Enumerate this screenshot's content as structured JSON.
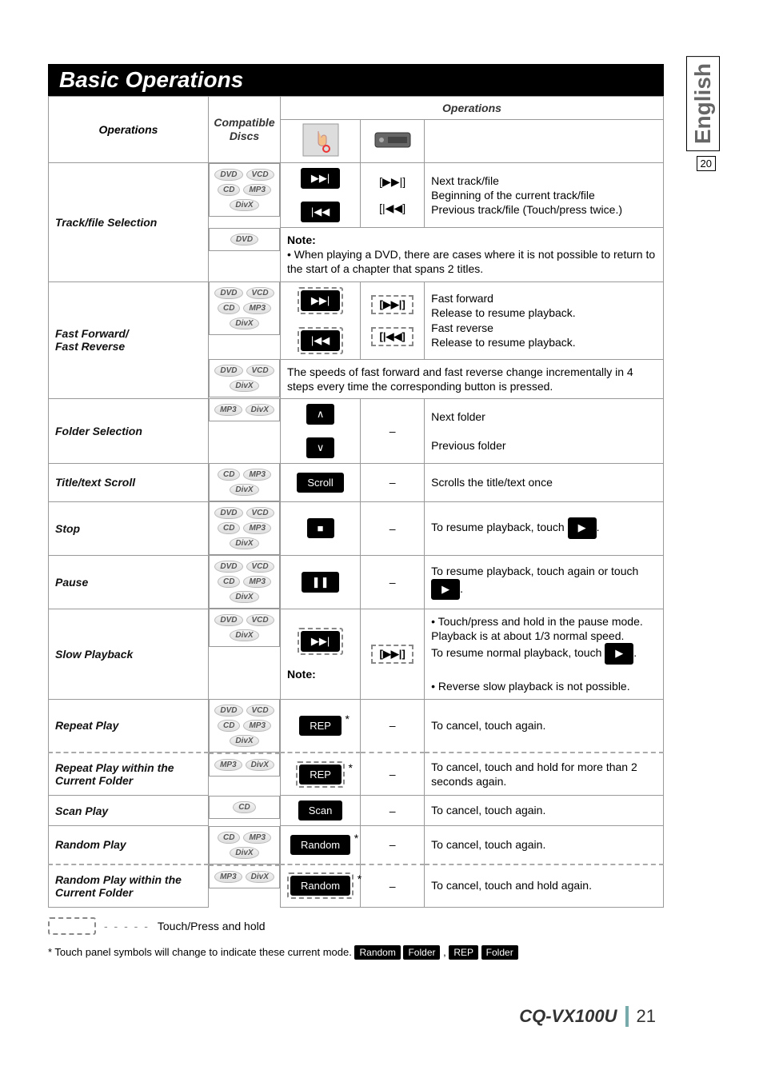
{
  "side_tab": {
    "lang": "English",
    "num": "20"
  },
  "section_title": "Basic Operations",
  "headers": {
    "operations_left": "Operations",
    "compatible_discs": "Compatible Discs",
    "operations_span": "Operations"
  },
  "discs": {
    "DVD": "DVD",
    "VCD": "VCD",
    "CD": "CD",
    "MP3": "MP3",
    "DivX": "DivX"
  },
  "rows": {
    "track_sel": {
      "label": "Track/file Selection",
      "remote_next": "[▶▶|]",
      "remote_prev": "[|◀◀]",
      "desc_next": "Next track/file",
      "desc_prev_line1": "Beginning of the current track/file",
      "desc_prev_line2": "Previous track/file (Touch/press twice.)",
      "note_label": "Note:",
      "note_text": "• When playing a DVD, there are cases where it is not possible to return to the start of a chapter that spans 2 titles."
    },
    "ffwd": {
      "label": "Fast Forward/\nFast Reverse",
      "remote_next": "[▶▶|]",
      "remote_prev": "[|◀◀]",
      "desc_ff": "Fast forward",
      "desc_ff2": "Release to resume playback.",
      "desc_fr": "Fast reverse",
      "desc_fr2": "Release to resume playback.",
      "speed_note": "The speeds of fast forward and fast reverse change incrementally in 4 steps every time the corresponding button is pressed."
    },
    "folder_sel": {
      "label": "Folder Selection",
      "remote": "–",
      "desc1": "Next folder",
      "desc2": "Previous folder"
    },
    "title_scroll": {
      "label": "Title/text Scroll",
      "btn": "Scroll",
      "remote": "–",
      "desc": "Scrolls the title/text once"
    },
    "stop": {
      "label": "Stop",
      "remote": "–",
      "desc_pre": "To resume playback, touch ",
      "desc_post": "."
    },
    "pause": {
      "label": "Pause",
      "remote": "–",
      "desc_pre": "To resume playback, touch again or touch ",
      "desc_post": "."
    },
    "slow": {
      "label": "Slow Playback",
      "remote": "[▶▶|]",
      "bullet": "• Touch/press and hold in the pause mode.",
      "line2": "Playback is at about 1/3 normal speed.",
      "line3_pre": "To resume normal playback, touch ",
      "line3_post": ".",
      "note_label": "Note:",
      "note_text": "• Reverse slow playback is not possible."
    },
    "repeat": {
      "label": "Repeat Play",
      "btn": "REP",
      "remote": "–",
      "desc": "To cancel, touch again."
    },
    "repeat_folder": {
      "label": "Repeat Play within the Current Folder",
      "btn": "REP",
      "remote": "–",
      "desc": "To cancel, touch and hold for more than 2 seconds again."
    },
    "scan": {
      "label": "Scan Play",
      "btn": "Scan",
      "remote": "–",
      "desc": "To cancel, touch again."
    },
    "random": {
      "label": "Random Play",
      "btn": "Random",
      "remote": "–",
      "desc": "To cancel, touch again."
    },
    "random_folder": {
      "label": "Random Play within the Current Folder",
      "btn": "Random",
      "remote": "–",
      "desc": "To cancel, touch and hold again."
    }
  },
  "legend_text": "Touch/Press and hold",
  "footnote_pre": "* Touch panel symbols will change to indicate these current mode. ",
  "footnote_badges": {
    "random": "Random",
    "folder1": "Folder",
    "sep": ",",
    "rep": "REP",
    "folder2": "Folder"
  },
  "footer": {
    "model": "CQ-VX100U",
    "page": "21"
  }
}
